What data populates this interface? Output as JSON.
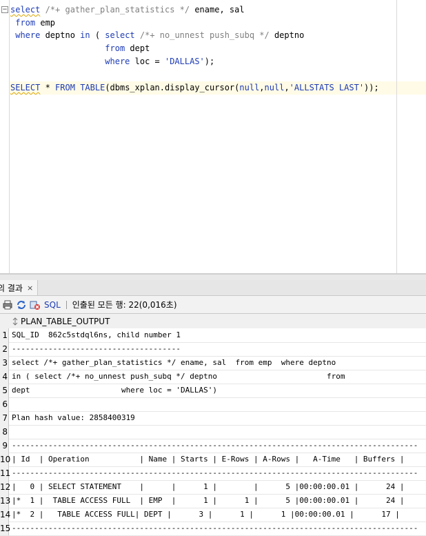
{
  "editor": {
    "lines": [
      {
        "parts": [
          {
            "t": "select",
            "c": "kw squig"
          },
          {
            "t": " /*+ gather_plan_statistics */ ",
            "c": "cm"
          },
          {
            "t": "ename, sal",
            "c": ""
          }
        ]
      },
      {
        "parts": [
          {
            "t": " from",
            "c": "kw"
          },
          {
            "t": " emp",
            "c": ""
          }
        ]
      },
      {
        "parts": [
          {
            "t": " where",
            "c": "kw"
          },
          {
            "t": " deptno ",
            "c": ""
          },
          {
            "t": "in",
            "c": "kw"
          },
          {
            "t": " ( ",
            "c": ""
          },
          {
            "t": "select",
            "c": "kw"
          },
          {
            "t": " /*+ no_unnest push_subq */ ",
            "c": "cm"
          },
          {
            "t": "deptno",
            "c": ""
          }
        ]
      },
      {
        "parts": [
          {
            "t": "                   from",
            "c": "kw"
          },
          {
            "t": " dept",
            "c": ""
          }
        ]
      },
      {
        "parts": [
          {
            "t": "                   where",
            "c": "kw"
          },
          {
            "t": " loc = ",
            "c": ""
          },
          {
            "t": "'DALLAS'",
            "c": "st"
          },
          {
            "t": ");",
            "c": ""
          }
        ]
      },
      {
        "parts": []
      },
      {
        "parts": [
          {
            "t": "SELECT",
            "c": "kw squig"
          },
          {
            "t": " * ",
            "c": ""
          },
          {
            "t": "FROM",
            "c": "kw"
          },
          {
            "t": " ",
            "c": ""
          },
          {
            "t": "TABLE",
            "c": "kw"
          },
          {
            "t": "(dbms_xplan.display_cursor(",
            "c": ""
          },
          {
            "t": "null",
            "c": "kw"
          },
          {
            "t": ",",
            "c": ""
          },
          {
            "t": "null",
            "c": "kw"
          },
          {
            "t": ",",
            "c": ""
          },
          {
            "t": "'ALLSTATS LAST'",
            "c": "st"
          },
          {
            "t": "));",
            "c": ""
          }
        ]
      }
    ]
  },
  "results_tab": {
    "label": "의 결과",
    "close": "×"
  },
  "toolbar": {
    "sql_label": "SQL",
    "status": "인출된 모든 행: 22(0,016초)"
  },
  "grid": {
    "column_header": "PLAN_TABLE_OUTPUT",
    "rows": [
      {
        "n": "1",
        "text": "SQL_ID  862c5stdql6ns, child number 1"
      },
      {
        "n": "2",
        "text": "-------------------------------------"
      },
      {
        "n": "3",
        "text": "select /*+ gather_plan_statistics */ ename, sal  from emp  where deptno"
      },
      {
        "n": "4",
        "text": "in ( select /*+ no_unnest push_subq */ deptno                        from"
      },
      {
        "n": "5",
        "text": "dept                    where loc = 'DALLAS')"
      },
      {
        "n": "6",
        "text": ""
      },
      {
        "n": "7",
        "text": "Plan hash value: 2858400319"
      },
      {
        "n": "8",
        "text": ""
      },
      {
        "n": "9",
        "text": "-----------------------------------------------------------------------------------------"
      },
      {
        "n": "10",
        "text": "| Id  | Operation           | Name | Starts | E-Rows | A-Rows |   A-Time   | Buffers |"
      },
      {
        "n": "11",
        "text": "-----------------------------------------------------------------------------------------"
      },
      {
        "n": "12",
        "text": "|   0 | SELECT STATEMENT    |      |      1 |        |      5 |00:00:00.01 |      24 |"
      },
      {
        "n": "13",
        "text": "|*  1 |  TABLE ACCESS FULL  | EMP  |      1 |      1 |      5 |00:00:00.01 |      24 |"
      },
      {
        "n": "14",
        "text": "|*  2 |   TABLE ACCESS FULL| DEPT |      3 |      1 |      1 |00:00:00.01 |      17 |"
      },
      {
        "n": "15",
        "text": "-----------------------------------------------------------------------------------------"
      }
    ]
  }
}
